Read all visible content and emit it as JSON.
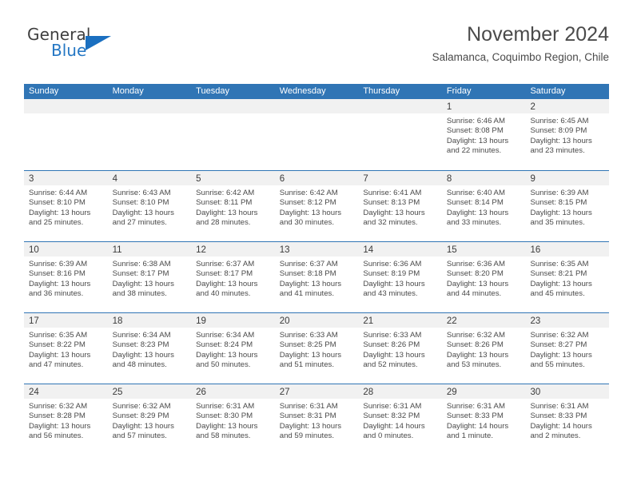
{
  "brand": {
    "name_part1": "General",
    "name_part2": "Blue",
    "triangle_color": "#1a6fc0",
    "text_color": "#3f3f3f",
    "blue_color": "#2577c4"
  },
  "header": {
    "title": "November 2024",
    "subtitle": "Salamanca, Coquimbo Region, Chile"
  },
  "colors": {
    "header_blue": "#3075b5",
    "daynum_band": "#f1f1f1",
    "text": "#4a4a4a"
  },
  "weekdays": [
    "Sunday",
    "Monday",
    "Tuesday",
    "Wednesday",
    "Thursday",
    "Friday",
    "Saturday"
  ],
  "labels": {
    "sunrise_prefix": "Sunrise:",
    "sunset_prefix": "Sunset:",
    "daylight_prefix": "Daylight:"
  },
  "weeks": [
    [
      {
        "day": "",
        "sunrise": "",
        "sunset": "",
        "daylight_line1": "",
        "daylight_line2": ""
      },
      {
        "day": "",
        "sunrise": "",
        "sunset": "",
        "daylight_line1": "",
        "daylight_line2": ""
      },
      {
        "day": "",
        "sunrise": "",
        "sunset": "",
        "daylight_line1": "",
        "daylight_line2": ""
      },
      {
        "day": "",
        "sunrise": "",
        "sunset": "",
        "daylight_line1": "",
        "daylight_line2": ""
      },
      {
        "day": "",
        "sunrise": "",
        "sunset": "",
        "daylight_line1": "",
        "daylight_line2": ""
      },
      {
        "day": "1",
        "sunrise": "Sunrise: 6:46 AM",
        "sunset": "Sunset: 8:08 PM",
        "daylight_line1": "Daylight: 13 hours",
        "daylight_line2": "and 22 minutes."
      },
      {
        "day": "2",
        "sunrise": "Sunrise: 6:45 AM",
        "sunset": "Sunset: 8:09 PM",
        "daylight_line1": "Daylight: 13 hours",
        "daylight_line2": "and 23 minutes."
      }
    ],
    [
      {
        "day": "3",
        "sunrise": "Sunrise: 6:44 AM",
        "sunset": "Sunset: 8:10 PM",
        "daylight_line1": "Daylight: 13 hours",
        "daylight_line2": "and 25 minutes."
      },
      {
        "day": "4",
        "sunrise": "Sunrise: 6:43 AM",
        "sunset": "Sunset: 8:10 PM",
        "daylight_line1": "Daylight: 13 hours",
        "daylight_line2": "and 27 minutes."
      },
      {
        "day": "5",
        "sunrise": "Sunrise: 6:42 AM",
        "sunset": "Sunset: 8:11 PM",
        "daylight_line1": "Daylight: 13 hours",
        "daylight_line2": "and 28 minutes."
      },
      {
        "day": "6",
        "sunrise": "Sunrise: 6:42 AM",
        "sunset": "Sunset: 8:12 PM",
        "daylight_line1": "Daylight: 13 hours",
        "daylight_line2": "and 30 minutes."
      },
      {
        "day": "7",
        "sunrise": "Sunrise: 6:41 AM",
        "sunset": "Sunset: 8:13 PM",
        "daylight_line1": "Daylight: 13 hours",
        "daylight_line2": "and 32 minutes."
      },
      {
        "day": "8",
        "sunrise": "Sunrise: 6:40 AM",
        "sunset": "Sunset: 8:14 PM",
        "daylight_line1": "Daylight: 13 hours",
        "daylight_line2": "and 33 minutes."
      },
      {
        "day": "9",
        "sunrise": "Sunrise: 6:39 AM",
        "sunset": "Sunset: 8:15 PM",
        "daylight_line1": "Daylight: 13 hours",
        "daylight_line2": "and 35 minutes."
      }
    ],
    [
      {
        "day": "10",
        "sunrise": "Sunrise: 6:39 AM",
        "sunset": "Sunset: 8:16 PM",
        "daylight_line1": "Daylight: 13 hours",
        "daylight_line2": "and 36 minutes."
      },
      {
        "day": "11",
        "sunrise": "Sunrise: 6:38 AM",
        "sunset": "Sunset: 8:17 PM",
        "daylight_line1": "Daylight: 13 hours",
        "daylight_line2": "and 38 minutes."
      },
      {
        "day": "12",
        "sunrise": "Sunrise: 6:37 AM",
        "sunset": "Sunset: 8:17 PM",
        "daylight_line1": "Daylight: 13 hours",
        "daylight_line2": "and 40 minutes."
      },
      {
        "day": "13",
        "sunrise": "Sunrise: 6:37 AM",
        "sunset": "Sunset: 8:18 PM",
        "daylight_line1": "Daylight: 13 hours",
        "daylight_line2": "and 41 minutes."
      },
      {
        "day": "14",
        "sunrise": "Sunrise: 6:36 AM",
        "sunset": "Sunset: 8:19 PM",
        "daylight_line1": "Daylight: 13 hours",
        "daylight_line2": "and 43 minutes."
      },
      {
        "day": "15",
        "sunrise": "Sunrise: 6:36 AM",
        "sunset": "Sunset: 8:20 PM",
        "daylight_line1": "Daylight: 13 hours",
        "daylight_line2": "and 44 minutes."
      },
      {
        "day": "16",
        "sunrise": "Sunrise: 6:35 AM",
        "sunset": "Sunset: 8:21 PM",
        "daylight_line1": "Daylight: 13 hours",
        "daylight_line2": "and 45 minutes."
      }
    ],
    [
      {
        "day": "17",
        "sunrise": "Sunrise: 6:35 AM",
        "sunset": "Sunset: 8:22 PM",
        "daylight_line1": "Daylight: 13 hours",
        "daylight_line2": "and 47 minutes."
      },
      {
        "day": "18",
        "sunrise": "Sunrise: 6:34 AM",
        "sunset": "Sunset: 8:23 PM",
        "daylight_line1": "Daylight: 13 hours",
        "daylight_line2": "and 48 minutes."
      },
      {
        "day": "19",
        "sunrise": "Sunrise: 6:34 AM",
        "sunset": "Sunset: 8:24 PM",
        "daylight_line1": "Daylight: 13 hours",
        "daylight_line2": "and 50 minutes."
      },
      {
        "day": "20",
        "sunrise": "Sunrise: 6:33 AM",
        "sunset": "Sunset: 8:25 PM",
        "daylight_line1": "Daylight: 13 hours",
        "daylight_line2": "and 51 minutes."
      },
      {
        "day": "21",
        "sunrise": "Sunrise: 6:33 AM",
        "sunset": "Sunset: 8:26 PM",
        "daylight_line1": "Daylight: 13 hours",
        "daylight_line2": "and 52 minutes."
      },
      {
        "day": "22",
        "sunrise": "Sunrise: 6:32 AM",
        "sunset": "Sunset: 8:26 PM",
        "daylight_line1": "Daylight: 13 hours",
        "daylight_line2": "and 53 minutes."
      },
      {
        "day": "23",
        "sunrise": "Sunrise: 6:32 AM",
        "sunset": "Sunset: 8:27 PM",
        "daylight_line1": "Daylight: 13 hours",
        "daylight_line2": "and 55 minutes."
      }
    ],
    [
      {
        "day": "24",
        "sunrise": "Sunrise: 6:32 AM",
        "sunset": "Sunset: 8:28 PM",
        "daylight_line1": "Daylight: 13 hours",
        "daylight_line2": "and 56 minutes."
      },
      {
        "day": "25",
        "sunrise": "Sunrise: 6:32 AM",
        "sunset": "Sunset: 8:29 PM",
        "daylight_line1": "Daylight: 13 hours",
        "daylight_line2": "and 57 minutes."
      },
      {
        "day": "26",
        "sunrise": "Sunrise: 6:31 AM",
        "sunset": "Sunset: 8:30 PM",
        "daylight_line1": "Daylight: 13 hours",
        "daylight_line2": "and 58 minutes."
      },
      {
        "day": "27",
        "sunrise": "Sunrise: 6:31 AM",
        "sunset": "Sunset: 8:31 PM",
        "daylight_line1": "Daylight: 13 hours",
        "daylight_line2": "and 59 minutes."
      },
      {
        "day": "28",
        "sunrise": "Sunrise: 6:31 AM",
        "sunset": "Sunset: 8:32 PM",
        "daylight_line1": "Daylight: 14 hours",
        "daylight_line2": "and 0 minutes."
      },
      {
        "day": "29",
        "sunrise": "Sunrise: 6:31 AM",
        "sunset": "Sunset: 8:33 PM",
        "daylight_line1": "Daylight: 14 hours",
        "daylight_line2": "and 1 minute."
      },
      {
        "day": "30",
        "sunrise": "Sunrise: 6:31 AM",
        "sunset": "Sunset: 8:33 PM",
        "daylight_line1": "Daylight: 14 hours",
        "daylight_line2": "and 2 minutes."
      }
    ]
  ]
}
